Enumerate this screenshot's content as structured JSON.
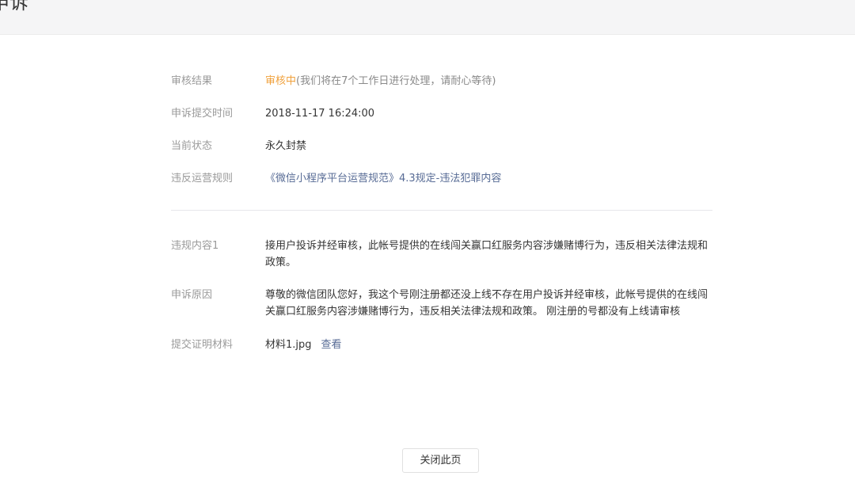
{
  "header": {
    "title": "申诉"
  },
  "details": {
    "review_result": {
      "label": "审核结果",
      "status": "审核中",
      "note": "(我们将在7个工作日进行处理，请耐心等待)"
    },
    "submit_time": {
      "label": "申诉提交时间",
      "value": "2018-11-17 16:24:00"
    },
    "current_state": {
      "label": "当前状态",
      "value": "永久封禁"
    },
    "violated_rule": {
      "label": "违反运营规则",
      "value": "《微信小程序平台运营规范》4.3规定-违法犯罪内容"
    },
    "violation_content": {
      "label": "违规内容1",
      "value": "接用户投诉并经审核，此帐号提供的在线闯关赢口红服务内容涉嫌赌博行为，违反相关法律法规和政策。"
    },
    "appeal_reason": {
      "label": "申诉原因",
      "value": "尊敬的微信团队您好，我这个号刚注册都还没上线不存在用户投诉并经审核，此帐号提供的在线闯关赢口红服务内容涉嫌赌博行为，违反相关法律法规和政策。 刚注册的号都没有上线请审核"
    },
    "evidence": {
      "label": "提交证明材料",
      "file_name": "材料1.jpg",
      "view_label": "查看"
    }
  },
  "footer": {
    "close_label": "关闭此页"
  }
}
